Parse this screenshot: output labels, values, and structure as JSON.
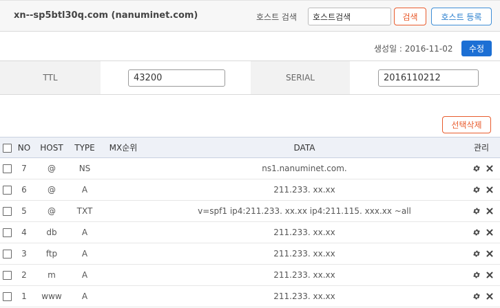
{
  "header": {
    "domain": "xn--sp5btl30q.com (nanuminet.com)",
    "search_label": "호스트 검색",
    "search_placeholder": "호스트검색",
    "search_button": "검색",
    "register_button": "호스트 등록"
  },
  "meta": {
    "created_text": "생성일 : 2016-11-02",
    "edit_button": "수정"
  },
  "soa": {
    "ttl_label": "TTL",
    "ttl_value": "43200",
    "serial_label": "SERIAL",
    "serial_value": "2016110212"
  },
  "actions": {
    "delete_selected": "선택삭제"
  },
  "table": {
    "headers": {
      "no": "NO",
      "host": "HOST",
      "type": "TYPE",
      "mx": "MX순위",
      "data": "DATA",
      "manage": "관리"
    },
    "rows": [
      {
        "no": "7",
        "host": "@",
        "type": "NS",
        "mx": "",
        "data": "ns1.nanuminet.com."
      },
      {
        "no": "6",
        "host": "@",
        "type": "A",
        "mx": "",
        "data": "211.233. xx.xx"
      },
      {
        "no": "5",
        "host": "@",
        "type": "TXT",
        "mx": "",
        "data": "v=spf1 ip4:211.233. xx.xx ip4:211.115. xxx.xx ~all"
      },
      {
        "no": "4",
        "host": "db",
        "type": "A",
        "mx": "",
        "data": "211.233. xx.xx"
      },
      {
        "no": "3",
        "host": "ftp",
        "type": "A",
        "mx": "",
        "data": "211.233. xx.xx"
      },
      {
        "no": "2",
        "host": "m",
        "type": "A",
        "mx": "",
        "data": "211.233. xx.xx"
      },
      {
        "no": "1",
        "host": "www",
        "type": "A",
        "mx": "",
        "data": "211.233. xx.xx"
      }
    ]
  },
  "icons": {
    "settings": "gear-icon",
    "delete": "close-icon"
  },
  "colors": {
    "accent_orange": "#e85a2b",
    "accent_blue": "#1c6fd4",
    "header_bg": "#eef1f7"
  }
}
